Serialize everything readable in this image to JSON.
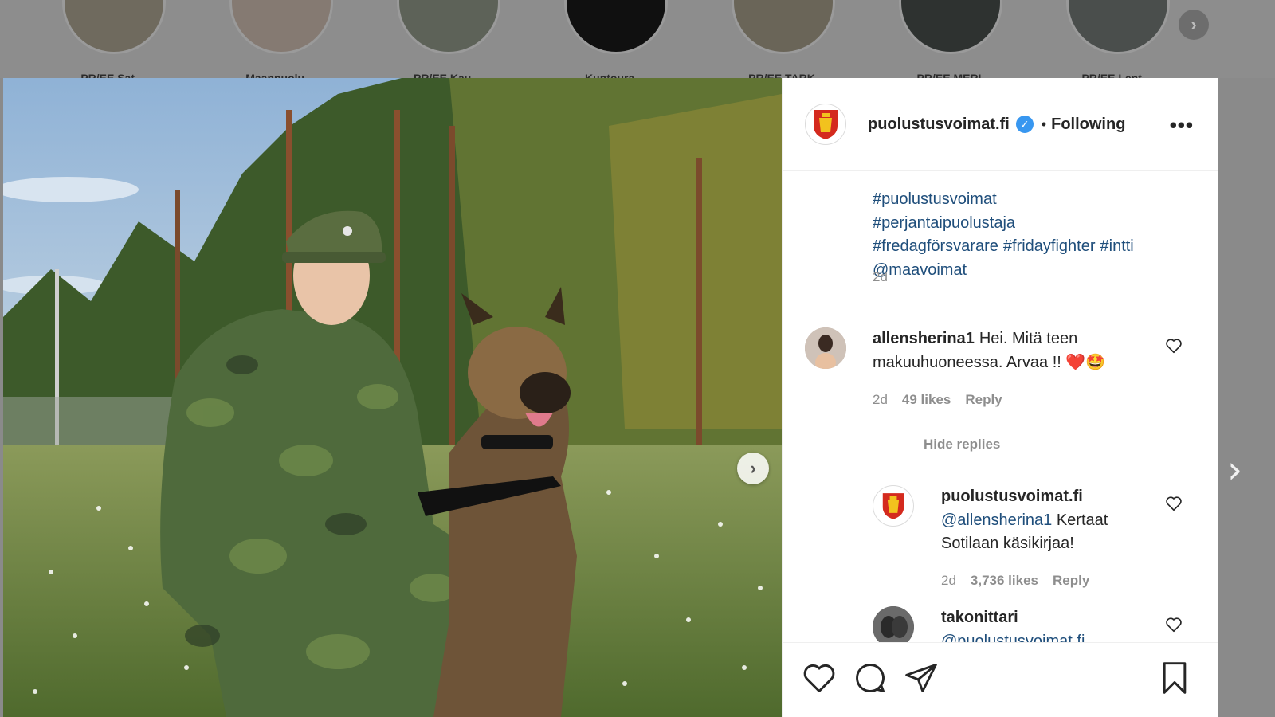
{
  "stories": [
    {
      "name": "PR/EE Sat..."
    },
    {
      "name": "Maanpuolu..."
    },
    {
      "name": "PR/EE Kau..."
    },
    {
      "name": "Kuntoura..."
    },
    {
      "name": "PR/EE TARK"
    },
    {
      "name": "PR/EE MERI"
    },
    {
      "name": "PR/EE Lent..."
    }
  ],
  "post": {
    "account": "puolustusvoimat.fi",
    "separator": "•",
    "follow_state": "Following",
    "more": "•••",
    "caption_tags": [
      "#puolustusvoimat",
      "#perjantaipuolustaja",
      "#fredagförsvarare",
      "#fridayfighter",
      "#intti",
      "@maavoimat"
    ],
    "caption_time": "2d"
  },
  "comments": [
    {
      "user": "allensherina1",
      "text": "Hei. Mitä teen makuuhuoneessa. Arvaa !!",
      "emoji": "❤️🤩",
      "time": "2d",
      "likes": "49 likes",
      "reply": "Reply"
    }
  ],
  "hide_replies": "Hide replies",
  "replies": [
    {
      "user": "puolustusvoimat.fi",
      "mention": "@allensherina1",
      "text": "Kertaat Sotilaan käsikirjaa!",
      "time": "2d",
      "likes": "3,736 likes",
      "reply": "Reply"
    },
    {
      "user": "takonittari",
      "mention": "@puolustusvoimat.fi",
      "text": ""
    }
  ],
  "colors": {
    "link": "#1f4e7b",
    "meta": "#8e8e8e",
    "verified": "#3897f0"
  }
}
